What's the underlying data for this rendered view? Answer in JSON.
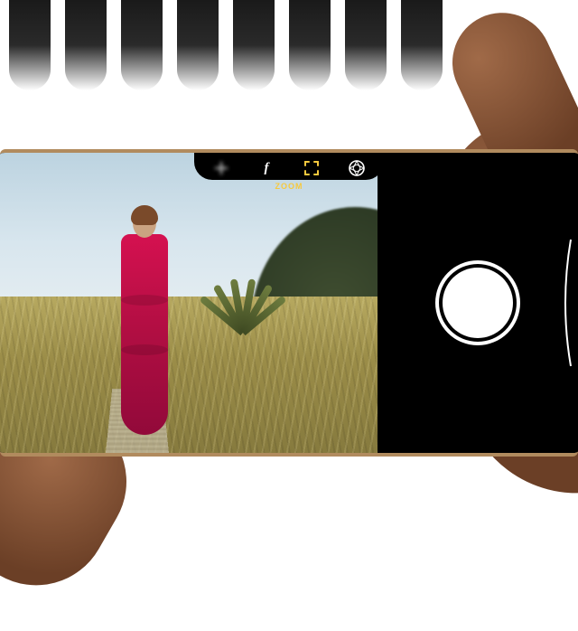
{
  "camera": {
    "toolbar": {
      "exposure_icon": "exposure-icon",
      "aperture_label": "f",
      "zoom_icon": "zoom-frame-icon",
      "filter_icon": "filter-icon"
    },
    "mode_label": "ZOOM",
    "active_control": "zoom",
    "shutter_label": "Shutter"
  },
  "colors": {
    "accent": "#f6c93e",
    "phone_frame": "#b18b5e",
    "dress": "#d51150"
  }
}
